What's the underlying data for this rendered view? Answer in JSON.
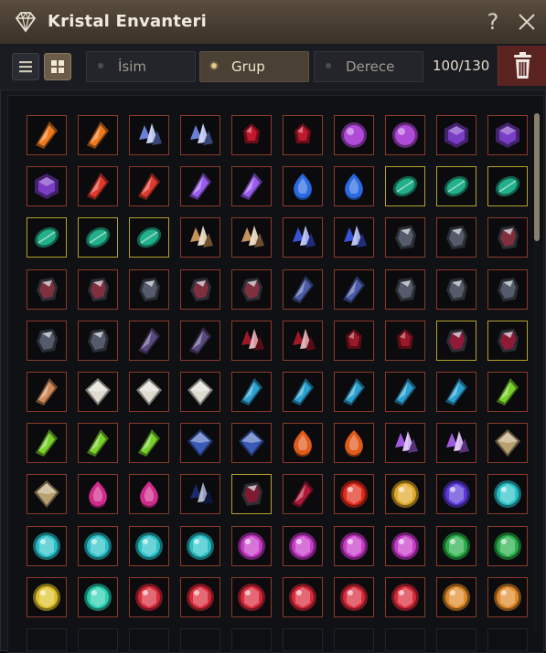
{
  "window": {
    "title": "Kristal Envanteri",
    "help_glyph": "?",
    "close_glyph": "✕"
  },
  "toolbar": {
    "sort_options": [
      {
        "label": "İsim",
        "selected": false
      },
      {
        "label": "Grup",
        "selected": true
      },
      {
        "label": "Derece",
        "selected": false
      }
    ],
    "capacity": "100/130"
  },
  "inventory": {
    "rows": [
      [
        {
          "color": "#f07a1a",
          "shape": "shard",
          "frame": "red"
        },
        {
          "color": "#f07a1a",
          "shape": "shard",
          "frame": "red"
        },
        {
          "color": "#6a7fd6",
          "shape": "cluster",
          "frame": "red"
        },
        {
          "color": "#6a7fd6",
          "shape": "cluster",
          "frame": "red"
        },
        {
          "color": "#c0182c",
          "shape": "gem",
          "frame": "red"
        },
        {
          "color": "#c0182c",
          "shape": "gem",
          "frame": "red"
        },
        {
          "color": "#b04ad8",
          "shape": "orb",
          "frame": "red"
        },
        {
          "color": "#b04ad8",
          "shape": "orb",
          "frame": "red"
        },
        {
          "color": "#7a3ec4",
          "shape": "hex",
          "frame": "red"
        },
        {
          "color": "#7a3ec4",
          "shape": "hex",
          "frame": "red"
        }
      ],
      [
        {
          "color": "#7a3ec4",
          "shape": "hex",
          "frame": "red"
        },
        {
          "color": "#e03a2e",
          "shape": "shard",
          "frame": "red"
        },
        {
          "color": "#e03a2e",
          "shape": "shard",
          "frame": "red"
        },
        {
          "color": "#9a5cf0",
          "shape": "shard",
          "frame": "red"
        },
        {
          "color": "#9a5cf0",
          "shape": "shard",
          "frame": "red"
        },
        {
          "color": "#2a6ae0",
          "shape": "drop",
          "frame": "red"
        },
        {
          "color": "#2a6ae0",
          "shape": "drop",
          "frame": "red"
        },
        {
          "color": "#22b08a",
          "shape": "leaf",
          "frame": "gold"
        },
        {
          "color": "#22b08a",
          "shape": "leaf",
          "frame": "gold"
        },
        {
          "color": "#22b08a",
          "shape": "leaf",
          "frame": "gold"
        }
      ],
      [
        {
          "color": "#22b08a",
          "shape": "leaf",
          "frame": "gold"
        },
        {
          "color": "#22b08a",
          "shape": "leaf",
          "frame": "gold"
        },
        {
          "color": "#22b08a",
          "shape": "leaf",
          "frame": "gold"
        },
        {
          "color": "#c4925a",
          "shape": "cluster",
          "frame": "red"
        },
        {
          "color": "#c4925a",
          "shape": "cluster",
          "frame": "red"
        },
        {
          "color": "#3a52d8",
          "shape": "cluster",
          "frame": "red"
        },
        {
          "color": "#3a52d8",
          "shape": "cluster",
          "frame": "red"
        },
        {
          "color": "#5a6070",
          "shape": "stone",
          "frame": "red"
        },
        {
          "color": "#5a6070",
          "shape": "stone",
          "frame": "red"
        },
        {
          "color": "#8a3040",
          "shape": "stone",
          "frame": "red"
        }
      ],
      [
        {
          "color": "#8a3040",
          "shape": "stone",
          "frame": "red"
        },
        {
          "color": "#8a3040",
          "shape": "stone",
          "frame": "red"
        },
        {
          "color": "#5a6070",
          "shape": "stone",
          "frame": "red"
        },
        {
          "color": "#8a3040",
          "shape": "stone",
          "frame": "red"
        },
        {
          "color": "#8a3040",
          "shape": "stone",
          "frame": "red"
        },
        {
          "color": "#4a5ca8",
          "shape": "shard",
          "frame": "red"
        },
        {
          "color": "#4a5ca8",
          "shape": "shard",
          "frame": "red"
        },
        {
          "color": "#5a6070",
          "shape": "stone",
          "frame": "red"
        },
        {
          "color": "#5a6070",
          "shape": "stone",
          "frame": "red"
        },
        {
          "color": "#5a6070",
          "shape": "stone",
          "frame": "red"
        }
      ],
      [
        {
          "color": "#5a6070",
          "shape": "stone",
          "frame": "red"
        },
        {
          "color": "#5a6070",
          "shape": "stone",
          "frame": "red"
        },
        {
          "color": "#5a4a80",
          "shape": "shard",
          "frame": "red"
        },
        {
          "color": "#5a4a80",
          "shape": "shard",
          "frame": "red"
        },
        {
          "color": "#a01828",
          "shape": "cluster",
          "frame": "red"
        },
        {
          "color": "#a01828",
          "shape": "cluster",
          "frame": "red"
        },
        {
          "color": "#9a1828",
          "shape": "gem",
          "frame": "red"
        },
        {
          "color": "#9a1828",
          "shape": "gem",
          "frame": "red"
        },
        {
          "color": "#9a1838",
          "shape": "stone",
          "frame": "gold"
        },
        {
          "color": "#9a1838",
          "shape": "stone",
          "frame": "gold"
        }
      ],
      [
        {
          "color": "#d08a5a",
          "shape": "shard",
          "frame": "red"
        },
        {
          "color": "#dedad0",
          "shape": "diamond",
          "frame": "red"
        },
        {
          "color": "#dedad0",
          "shape": "diamond",
          "frame": "red"
        },
        {
          "color": "#dedad0",
          "shape": "diamond",
          "frame": "red"
        },
        {
          "color": "#2aa0d0",
          "shape": "shard",
          "frame": "red"
        },
        {
          "color": "#2aa0d0",
          "shape": "shard",
          "frame": "red"
        },
        {
          "color": "#2aa0d0",
          "shape": "shard",
          "frame": "red"
        },
        {
          "color": "#2aa0d0",
          "shape": "shard",
          "frame": "red"
        },
        {
          "color": "#2aa0d0",
          "shape": "shard",
          "frame": "red"
        },
        {
          "color": "#7ad02a",
          "shape": "shard",
          "frame": "red"
        }
      ],
      [
        {
          "color": "#7ad02a",
          "shape": "shard",
          "frame": "red"
        },
        {
          "color": "#7ad02a",
          "shape": "shard",
          "frame": "red"
        },
        {
          "color": "#7ad02a",
          "shape": "shard",
          "frame": "red"
        },
        {
          "color": "#3a5ab8",
          "shape": "diamond",
          "frame": "red"
        },
        {
          "color": "#3a5ab8",
          "shape": "diamond",
          "frame": "red"
        },
        {
          "color": "#e05a1a",
          "shape": "drop",
          "frame": "red"
        },
        {
          "color": "#e05a1a",
          "shape": "drop",
          "frame": "red"
        },
        {
          "color": "#a05ae0",
          "shape": "cluster",
          "frame": "red"
        },
        {
          "color": "#a05ae0",
          "shape": "cluster",
          "frame": "red"
        },
        {
          "color": "#b8a070",
          "shape": "diamond",
          "frame": "red"
        }
      ],
      [
        {
          "color": "#b8a070",
          "shape": "diamond",
          "frame": "red"
        },
        {
          "color": "#d02a8a",
          "shape": "drop",
          "frame": "red"
        },
        {
          "color": "#d02a8a",
          "shape": "drop",
          "frame": "red"
        },
        {
          "color": "#1a2a6a",
          "shape": "cluster",
          "frame": "red"
        },
        {
          "color": "#8a1830",
          "shape": "stone",
          "frame": "gold"
        },
        {
          "color": "#b01838",
          "shape": "shard",
          "frame": "red"
        },
        {
          "color": "#e02a1a",
          "shape": "round",
          "frame": "red"
        },
        {
          "color": "#e0a82a",
          "shape": "round",
          "frame": "red"
        },
        {
          "color": "#5a3ad8",
          "shape": "round",
          "frame": "red"
        },
        {
          "color": "#2ac0c8",
          "shape": "round",
          "frame": "red"
        }
      ],
      [
        {
          "color": "#2ac0c8",
          "shape": "round",
          "frame": "red"
        },
        {
          "color": "#2ac0c8",
          "shape": "round",
          "frame": "red"
        },
        {
          "color": "#2ac0c8",
          "shape": "round",
          "frame": "red"
        },
        {
          "color": "#2ac0c8",
          "shape": "round",
          "frame": "red"
        },
        {
          "color": "#c83ac8",
          "shape": "round",
          "frame": "red"
        },
        {
          "color": "#c83ac8",
          "shape": "round",
          "frame": "red"
        },
        {
          "color": "#c83ac8",
          "shape": "round",
          "frame": "red"
        },
        {
          "color": "#c83ac8",
          "shape": "round",
          "frame": "red"
        },
        {
          "color": "#2ab04a",
          "shape": "round",
          "frame": "red"
        },
        {
          "color": "#2ab04a",
          "shape": "round",
          "frame": "red"
        }
      ],
      [
        {
          "color": "#e0c02a",
          "shape": "round",
          "frame": "red"
        },
        {
          "color": "#2ad0b0",
          "shape": "round",
          "frame": "red"
        },
        {
          "color": "#d82a3a",
          "shape": "round",
          "frame": "red"
        },
        {
          "color": "#d82a3a",
          "shape": "round",
          "frame": "red"
        },
        {
          "color": "#d82a3a",
          "shape": "round",
          "frame": "red"
        },
        {
          "color": "#d82a3a",
          "shape": "round",
          "frame": "red"
        },
        {
          "color": "#d82a3a",
          "shape": "round",
          "frame": "red"
        },
        {
          "color": "#d82a3a",
          "shape": "round",
          "frame": "red"
        },
        {
          "color": "#e08a2a",
          "shape": "round",
          "frame": "red"
        },
        {
          "color": "#e08a2a",
          "shape": "round",
          "frame": "red"
        }
      ]
    ],
    "empty_row_count": 10
  }
}
